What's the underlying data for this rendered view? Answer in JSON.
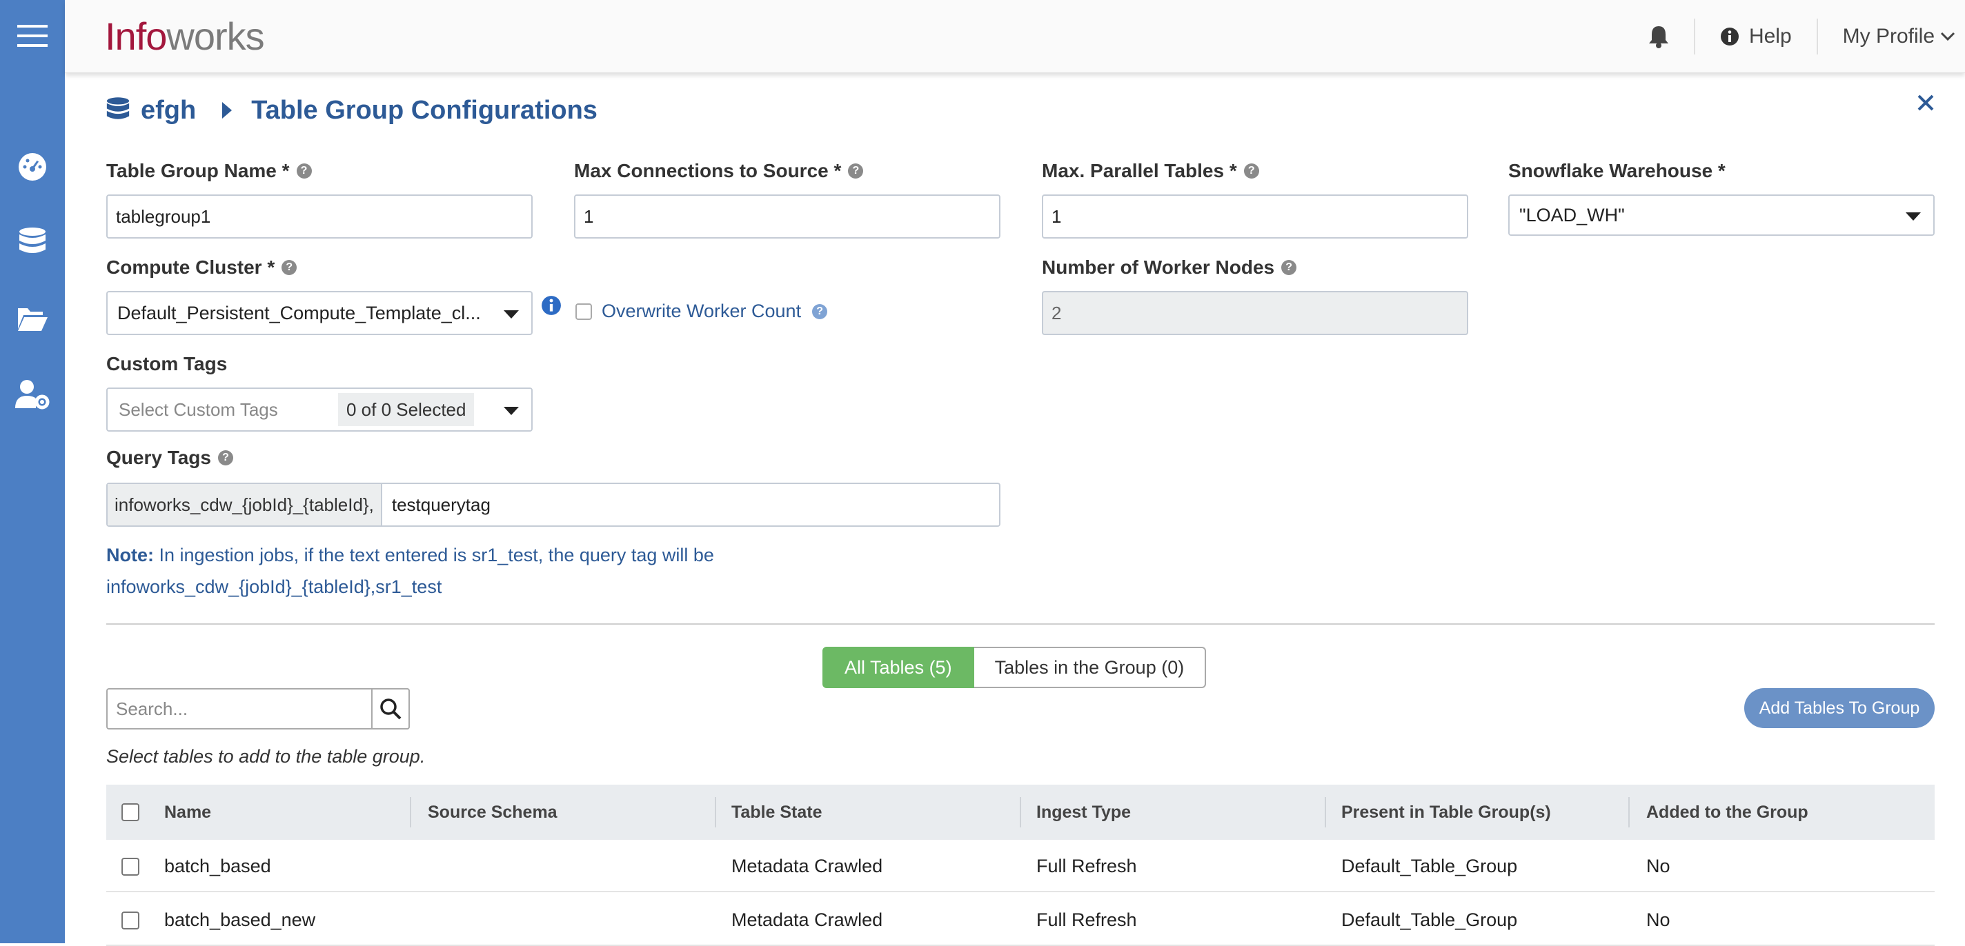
{
  "app": {
    "logo_part1": "Info",
    "logo_part2": "works"
  },
  "topbar": {
    "help_label": "Help",
    "profile_label": "My Profile"
  },
  "sidebar": {
    "items": [
      {
        "icon": "hamburger-icon"
      },
      {
        "icon": "dashboard-icon"
      },
      {
        "icon": "database-icon"
      },
      {
        "icon": "folder-icon"
      },
      {
        "icon": "user-settings-icon"
      }
    ]
  },
  "breadcrumb": {
    "source": "efgh",
    "page": "Table Group Configurations"
  },
  "form": {
    "table_group_name": {
      "label": "Table Group Name *",
      "value": "tablegroup1"
    },
    "max_connections": {
      "label": "Max Connections to Source *",
      "value": "1"
    },
    "max_parallel": {
      "label": "Max. Parallel Tables *",
      "value": "1"
    },
    "warehouse": {
      "label": "Snowflake Warehouse *",
      "value": "\"LOAD_WH\""
    },
    "compute_cluster": {
      "label": "Compute Cluster *",
      "value": "Default_Persistent_Compute_Template_cl..."
    },
    "overwrite_worker_count": {
      "label": "Overwrite Worker Count",
      "checked": false
    },
    "worker_nodes": {
      "label": "Number of Worker Nodes",
      "value": "2"
    },
    "custom_tags": {
      "label": "Custom Tags",
      "placeholder": "Select Custom Tags",
      "count": "0 of 0 Selected"
    },
    "query_tags": {
      "label": "Query Tags",
      "prefix": "infoworks_cdw_{jobId}_{tableId},",
      "value": "testquerytag"
    }
  },
  "note": {
    "bold": "Note:",
    "line1": " In ingestion jobs, if the text entered is sr1_test, the query tag will be",
    "line2": "infoworks_cdw_{jobId}_{tableId},sr1_test"
  },
  "tabs": {
    "all": "All Tables (5)",
    "in_group": "Tables in the Group (0)"
  },
  "search": {
    "placeholder": "Search..."
  },
  "add_button": "Add Tables To Group",
  "hint": "Select tables to add to the table group.",
  "table": {
    "columns": [
      "Name",
      "Source Schema",
      "Table State",
      "Ingest Type",
      "Present in Table Group(s)",
      "Added to the Group"
    ],
    "rows": [
      {
        "name": "batch_based",
        "schema": "",
        "state": "Metadata Crawled",
        "ingest": "Full Refresh",
        "present": "Default_Table_Group",
        "added": "No"
      },
      {
        "name": "batch_based_new",
        "schema": "",
        "state": "Metadata Crawled",
        "ingest": "Full Refresh",
        "present": "Default_Table_Group",
        "added": "No"
      }
    ]
  },
  "colors": {
    "sidebar": "#4c7fc4",
    "accent_blue": "#2d5a96",
    "green": "#6cb964",
    "logo_red": "#a3173d"
  }
}
